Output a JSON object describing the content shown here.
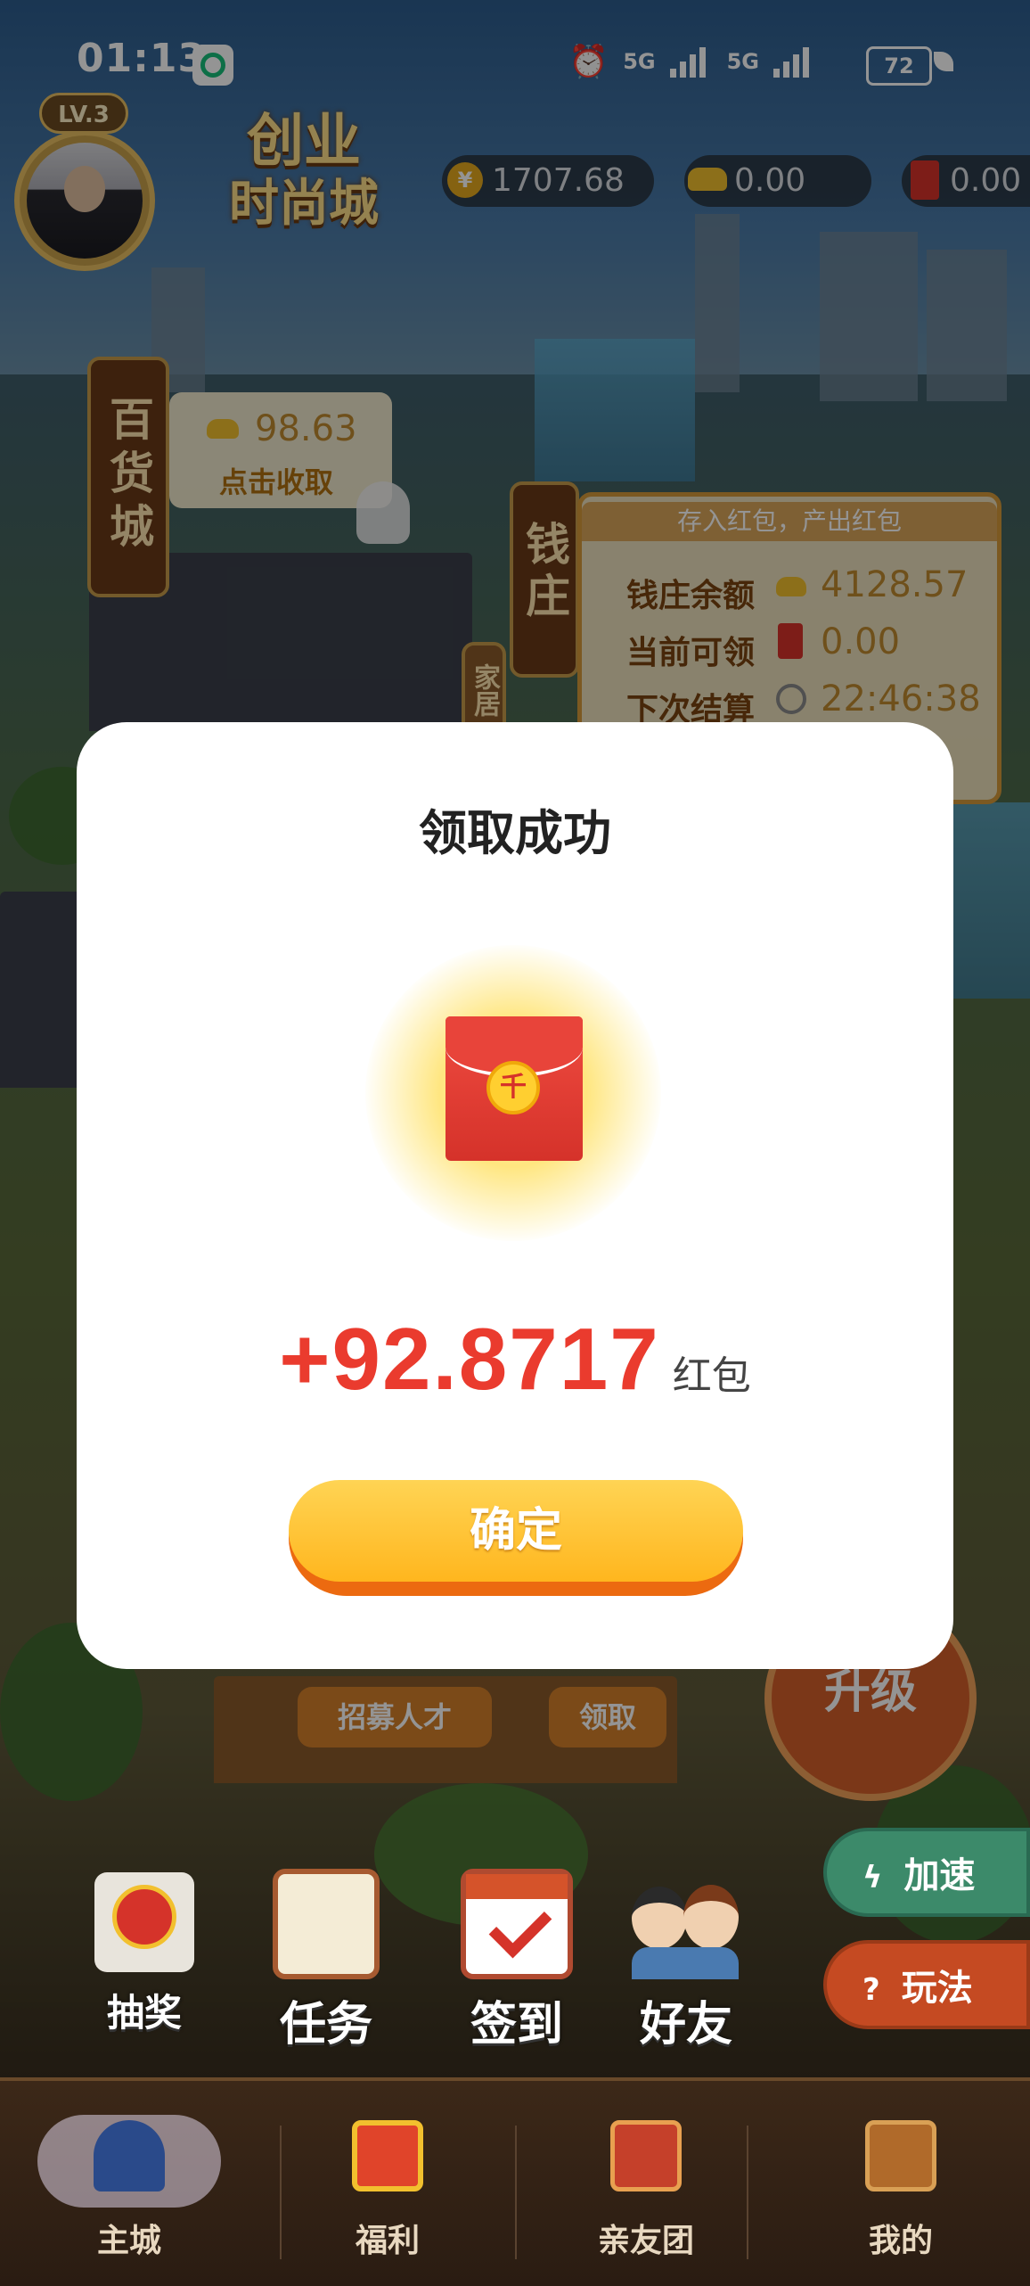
{
  "status_bar": {
    "time": "01:13",
    "network_1": "5G",
    "network_2": "5G",
    "battery": "72"
  },
  "profile": {
    "level": "LV.3"
  },
  "logo": {
    "line1": "创业",
    "line2": "时尚城"
  },
  "currencies": [
    {
      "icon": "yuan-coin-icon",
      "symbol": "¥",
      "value": "1707.68"
    },
    {
      "icon": "gold-ingot-icon",
      "value": "0.00"
    },
    {
      "icon": "red-packet-icon",
      "value": "0.00"
    }
  ],
  "department_store": {
    "sign": "百货城",
    "bubble_value": "98.63",
    "bubble_action": "点击收取"
  },
  "bank": {
    "sign": "钱庄",
    "subtitle": "存入红包，产出红包",
    "rows": [
      {
        "label": "钱庄余额",
        "icon": "gold-ingot-icon",
        "value": "4128.57"
      },
      {
        "label": "当前可领",
        "icon": "red-packet-icon",
        "value": "0.00"
      },
      {
        "label": "下次结算",
        "icon": "clock-icon",
        "value": "22:46:38"
      }
    ]
  },
  "home_sign": "家居",
  "background_buttons": {
    "recruit": "招募人才",
    "claim": "领取",
    "upgrade": "升级"
  },
  "modal": {
    "title": "领取成功",
    "amount": "+92.8717",
    "unit": "红包",
    "confirm": "确定"
  },
  "quick_actions": [
    {
      "label": "抽奖",
      "icon": "lottery-wheel-icon"
    },
    {
      "label": "任务",
      "icon": "task-scroll-icon"
    },
    {
      "label": "签到",
      "icon": "checkin-calendar-icon"
    },
    {
      "label": "好友",
      "icon": "friends-icon"
    }
  ],
  "side_buttons": {
    "speed": "加速",
    "howto": "玩法"
  },
  "tabs": [
    {
      "label": "主城",
      "icon": "palace-icon",
      "active": true
    },
    {
      "label": "福利",
      "icon": "gift-icon",
      "active": false
    },
    {
      "label": "亲友团",
      "icon": "banner-icon",
      "active": false
    },
    {
      "label": "我的",
      "icon": "book-icon",
      "active": false
    }
  ],
  "colors": {
    "amount_red": "#ea3b2e",
    "confirm_yellow": "#ffc43a",
    "confirm_shadow": "#ec6a10",
    "tabbar_brown": "#3c2818"
  }
}
